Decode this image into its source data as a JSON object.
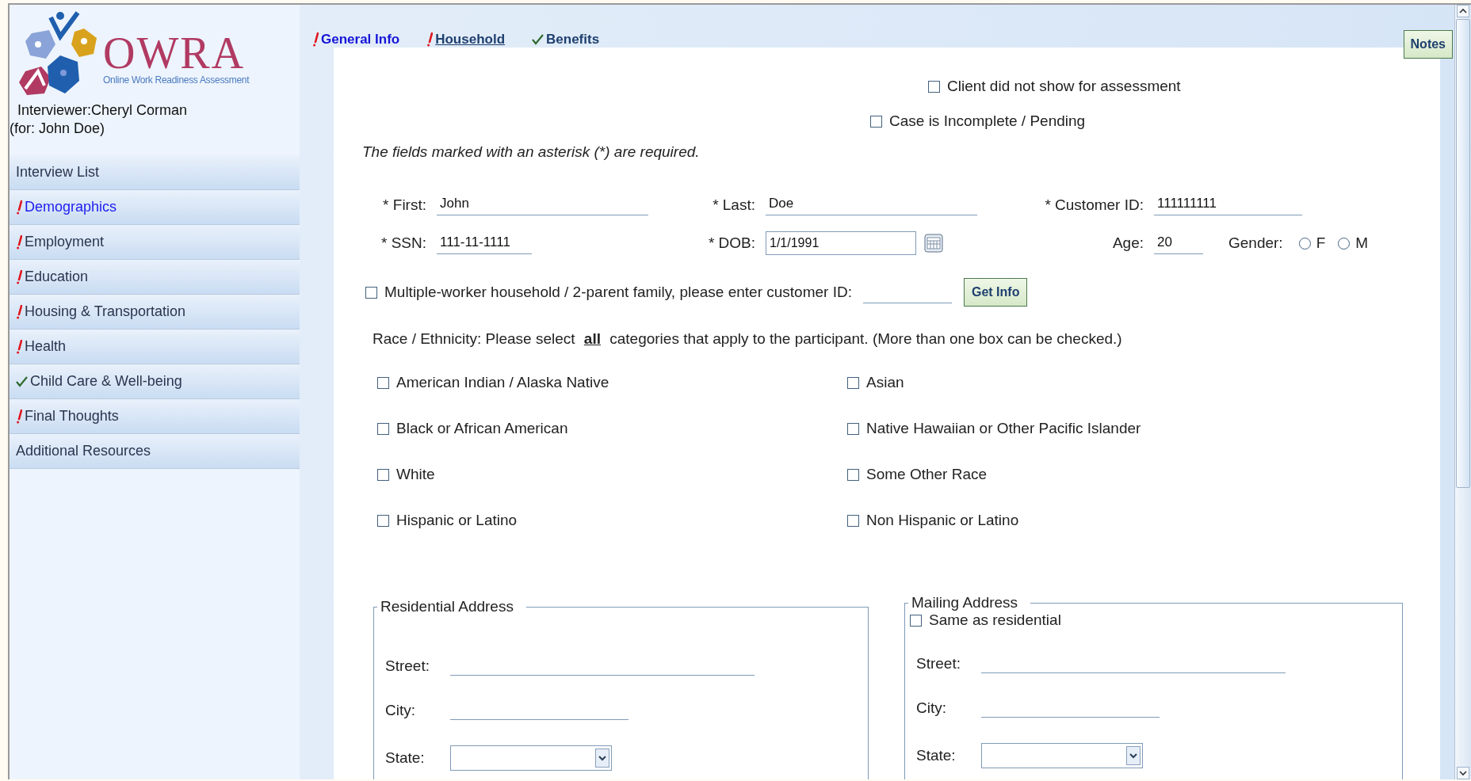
{
  "header": {
    "logo_text": "OWRA",
    "logo_subtitle": "Online Work Readiness Assessment",
    "interviewer": "Interviewer:Cheryl Corman",
    "client": "(for: John Doe)"
  },
  "sidebar": {
    "items": [
      {
        "label": "Interview List",
        "kind": "plain",
        "selected": false
      },
      {
        "label": "Demographics",
        "kind": "incomplete",
        "selected": true
      },
      {
        "label": "Employment",
        "kind": "incomplete",
        "selected": false
      },
      {
        "label": "Education",
        "kind": "incomplete",
        "selected": false
      },
      {
        "label": "Housing & Transportation",
        "kind": "incomplete",
        "selected": false
      },
      {
        "label": "Health",
        "kind": "incomplete",
        "selected": false
      },
      {
        "label": "Child Care & Well-being",
        "kind": "complete",
        "selected": false
      },
      {
        "label": "Final Thoughts",
        "kind": "incomplete",
        "selected": false
      },
      {
        "label": "Additional Resources",
        "kind": "plain",
        "selected": false
      }
    ]
  },
  "tabs": [
    {
      "label": "General Info",
      "kind": "incomplete",
      "selected": false,
      "highlighted": true
    },
    {
      "label": "Household",
      "kind": "incomplete",
      "selected": true,
      "highlighted": false
    },
    {
      "label": "Benefits",
      "kind": "complete",
      "selected": false,
      "highlighted": false
    }
  ],
  "notes_button": "Notes",
  "flags": [
    {
      "label": "Client did not show for assessment",
      "checked": false
    },
    {
      "label": "Case is Incomplete / Pending",
      "checked": false
    }
  ],
  "required_note": "The fields marked with an asterisk (*) are required.",
  "person_fields": [
    {
      "label": "* First:",
      "value": "John"
    },
    {
      "label": "* Last:",
      "value": "Doe"
    },
    {
      "label": "* Customer ID:",
      "value": "111111111"
    }
  ],
  "ssn": {
    "label": "* SSN:",
    "value": "111-11-1111"
  },
  "dob": {
    "label": "* DOB:",
    "value": "1/1/1991"
  },
  "age": {
    "label": "Age:",
    "value": "20"
  },
  "gender": {
    "label": "Gender:",
    "options": [
      {
        "label": "F",
        "selected": false
      },
      {
        "label": "M",
        "selected": false
      }
    ]
  },
  "multi_worker": {
    "label": "Multiple-worker household / 2-parent family, please enter customer ID:",
    "checked": false,
    "button": "Get Info"
  },
  "race": {
    "prompt": "Race / Ethnicity: Please select **all** categories that apply to the participant. (More than one box can be checked.)",
    "options": [
      {
        "label": "American Indian / Alaska Native",
        "checked": false
      },
      {
        "label": "Asian",
        "checked": false
      },
      {
        "label": "Black or African American",
        "checked": false
      },
      {
        "label": "Native Hawaiian or Other Pacific Islander",
        "checked": false
      },
      {
        "label": "White",
        "checked": false
      },
      {
        "label": "Some Other Race",
        "checked": false
      },
      {
        "label": "Hispanic or Latino",
        "checked": false
      },
      {
        "label": "Non Hispanic or Latino",
        "checked": false
      }
    ]
  },
  "addresses": [
    {
      "title": "Residential Address",
      "fields": [
        {
          "label": "Street:",
          "kind": "text"
        },
        {
          "label": "City:",
          "kind": "short"
        },
        {
          "label": "State:",
          "kind": "select"
        }
      ]
    },
    {
      "title": "Mailing Address",
      "same_as": {
        "label": "Same as residential",
        "checked": false
      },
      "fields": [
        {
          "label": "Street:",
          "kind": "text"
        },
        {
          "label": "City:",
          "kind": "short"
        },
        {
          "label": "State:",
          "kind": "select"
        }
      ]
    }
  ]
}
